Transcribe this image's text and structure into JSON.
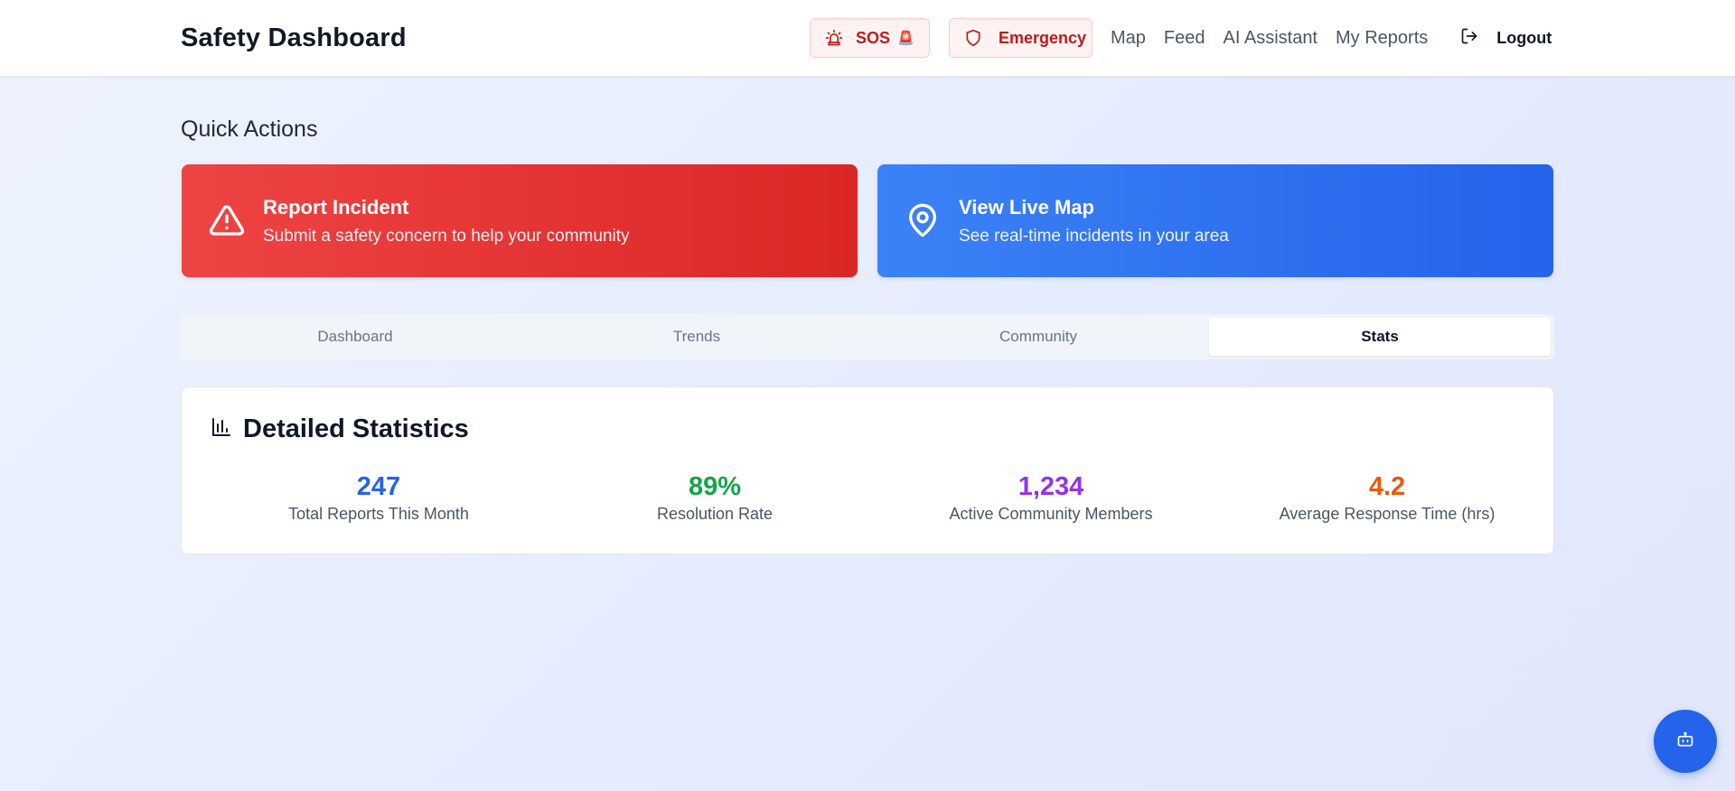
{
  "header": {
    "title": "Safety Dashboard",
    "sos_label": "SOS",
    "sos_emoji": "🚨",
    "emergency_label": "Emergency",
    "nav": [
      "Map",
      "Feed",
      "AI Assistant",
      "My Reports"
    ],
    "logout_label": "Logout"
  },
  "quick_actions": {
    "title": "Quick Actions",
    "report": {
      "title": "Report Incident",
      "subtitle": "Submit a safety concern to help your community"
    },
    "map": {
      "title": "View Live Map",
      "subtitle": "See real-time incidents in your area"
    }
  },
  "tabs": [
    "Dashboard",
    "Trends",
    "Community",
    "Stats"
  ],
  "active_tab": "Stats",
  "statistics": {
    "title": "Detailed Statistics",
    "items": [
      {
        "value": "247",
        "label": "Total Reports This Month",
        "color": "#2563eb"
      },
      {
        "value": "89%",
        "label": "Resolution Rate",
        "color": "#16a34a"
      },
      {
        "value": "1,234",
        "label": "Active Community Members",
        "color": "#9333ea"
      },
      {
        "value": "4.2",
        "label": "Average Response Time (hrs)",
        "color": "#ea580c"
      }
    ]
  },
  "icons": {
    "sos": "siren-icon",
    "emergency": "shield-icon",
    "logout": "logout-icon",
    "report": "alert-triangle-icon",
    "map": "map-pin-icon",
    "stats": "bar-chart-icon",
    "fab": "bot-icon"
  },
  "colors": {
    "emergency_red": "#b91c1c",
    "report_card": "#ef4444",
    "map_card": "#3b82f6",
    "fab": "#2563eb"
  }
}
